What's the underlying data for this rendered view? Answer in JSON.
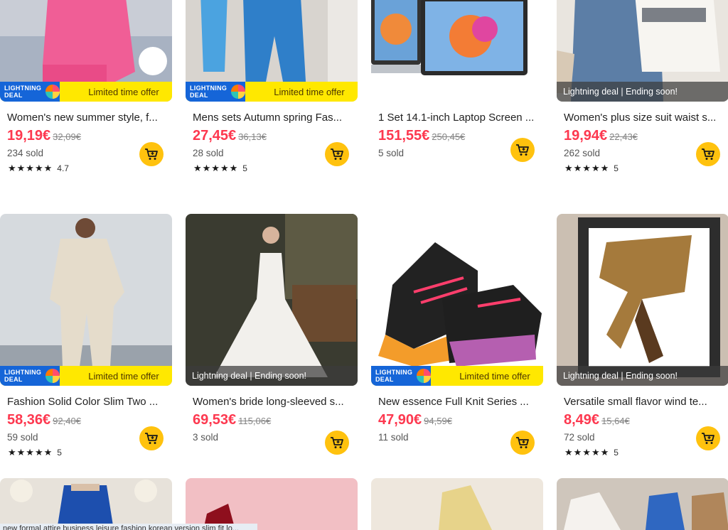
{
  "products": [
    {
      "title": "Women's new summer style, f...",
      "price": "19,19€",
      "old_price": "32,09€",
      "sold": "234 sold",
      "stars": "★★★★★",
      "rating": "4.7",
      "banner": "lightning",
      "banner_text": "Limited time offer"
    },
    {
      "title": "Mens sets Autumn spring Fas...",
      "price": "27,45€",
      "old_price": "36,13€",
      "sold": "28 sold",
      "stars": "★★★★★",
      "rating": "5",
      "banner": "lightning",
      "banner_text": "Limited time offer"
    },
    {
      "title": "1 Set 14.1-inch Laptop Screen ...",
      "price": "151,55€",
      "old_price": "250,45€",
      "sold": "5 sold",
      "stars": "",
      "rating": "",
      "banner": "none",
      "banner_text": ""
    },
    {
      "title": "Women's plus size suit waist s...",
      "price": "19,94€",
      "old_price": "22,43€",
      "sold": "262 sold",
      "stars": "★★★★★",
      "rating": "5",
      "banner": "dark",
      "banner_text": "Lightning deal | Ending soon!"
    },
    {
      "title": "Fashion Solid Color Slim Two ...",
      "price": "58,36€",
      "old_price": "92,40€",
      "sold": "59 sold",
      "stars": "★★★★★",
      "rating": "5",
      "banner": "lightning",
      "banner_text": "Limited time offer"
    },
    {
      "title": "Women's bride long-sleeved s...",
      "price": "69,53€",
      "old_price": "115,06€",
      "sold": "3 sold",
      "stars": "",
      "rating": "",
      "banner": "dark",
      "banner_text": "Lightning deal | Ending soon!"
    },
    {
      "title": "New essence Full Knit Series ...",
      "price": "47,90€",
      "old_price": "94,59€",
      "sold": "11 sold",
      "stars": "",
      "rating": "",
      "banner": "lightning",
      "banner_text": "Limited time offer"
    },
    {
      "title": "Versatile small flavor wind te...",
      "price": "8,49€",
      "old_price": "15,64€",
      "sold": "72 sold",
      "stars": "★★★★★",
      "rating": "5",
      "banner": "dark",
      "banner_text": "Lightning deal | Ending soon!"
    }
  ],
  "lightning_badge_text": "LIGHTNING DEAL",
  "partial_bottom_text": "new formal attire business leisure fashion korean version slim fit lo...",
  "colors": {
    "price": "#fd384f",
    "cart": "#ffc20e",
    "lightning_bar": "#ffe800",
    "badge": "#1565d8"
  },
  "icons": {
    "cart": "cart-plus-icon",
    "star": "star-icon"
  }
}
